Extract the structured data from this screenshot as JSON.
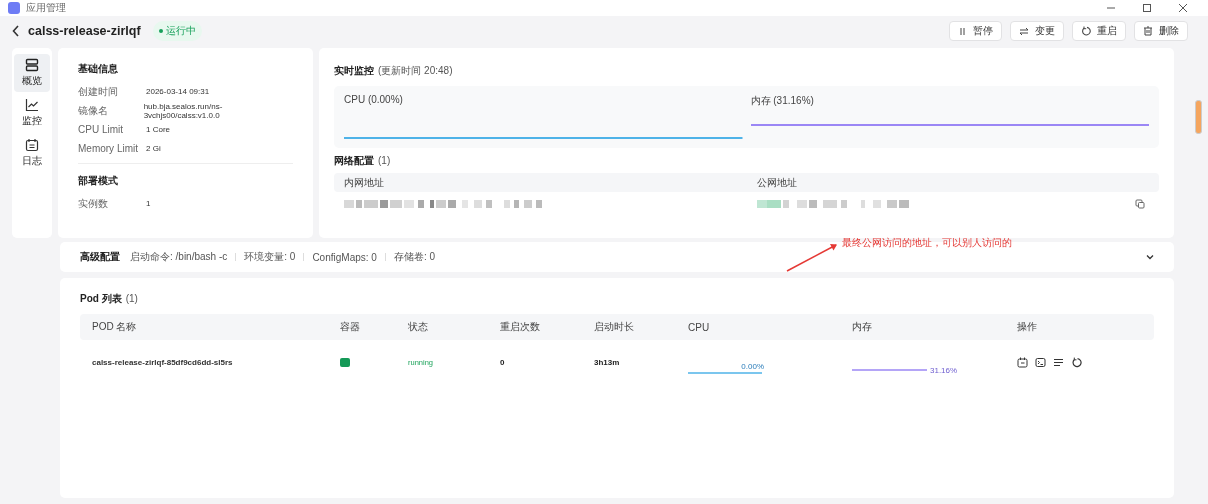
{
  "window": {
    "title": "应用管理"
  },
  "header": {
    "name": "calss-release-zirlqf",
    "status": "运行中",
    "running": true
  },
  "actions": [
    {
      "kind": "pause",
      "label": "暂停"
    },
    {
      "kind": "change",
      "label": "变更"
    },
    {
      "kind": "restart",
      "label": "重启"
    },
    {
      "kind": "delete",
      "label": "删除"
    }
  ],
  "sidebar": {
    "items": [
      {
        "kind": "overview",
        "label": "概览",
        "selected": true
      },
      {
        "kind": "monitor",
        "label": "监控",
        "selected": false
      },
      {
        "kind": "logs",
        "label": "日志",
        "selected": false
      }
    ]
  },
  "basic_info": {
    "title": "基础信息",
    "rows": [
      {
        "label": "创建时间",
        "value": "2026-03-14 09:31"
      },
      {
        "label": "镜像名",
        "value": "hub.bja.sealos.run/ns-3vchjs00/calss:v1.0.0"
      },
      {
        "label": "CPU Limit",
        "value": "1 Core"
      },
      {
        "label": "Memory Limit",
        "value": "2 Gi"
      }
    ]
  },
  "deploy_mode": {
    "title": "部署模式",
    "rows": [
      {
        "label": "实例数",
        "value": "1"
      }
    ]
  },
  "monitor": {
    "title": "实时监控",
    "updated": "(更新时间  20:48)",
    "charts": [
      {
        "label": "CPU  (0.00%)",
        "color": "#4fb3e8"
      },
      {
        "label": "内存  (31.16%)",
        "color": "#9b87f5"
      }
    ]
  },
  "network": {
    "title": "网络配置",
    "count": "(1)",
    "columns": [
      "内网地址",
      "公网地址"
    ]
  },
  "annotation": "最终公网访问的地址，可以别人访问的",
  "advanced": {
    "title": "高级配置",
    "items": [
      "启动命令: /bin/bash -c",
      "环境变量: 0",
      "ConfigMaps: 0",
      "存储卷: 0"
    ]
  },
  "pods": {
    "title": "Pod 列表",
    "count": "(1)",
    "columns": [
      "POD 名称",
      "容器",
      "状态",
      "重启次数",
      "启动时长",
      "CPU",
      "内存",
      "操作"
    ],
    "rows": [
      {
        "name": "calss-release-zirlqf-85df9cd6dd-sl5rs",
        "status": "running",
        "restarts": "0",
        "uptime": "3h13m",
        "cpu": "0.00%",
        "memory": "31.16%"
      }
    ]
  }
}
